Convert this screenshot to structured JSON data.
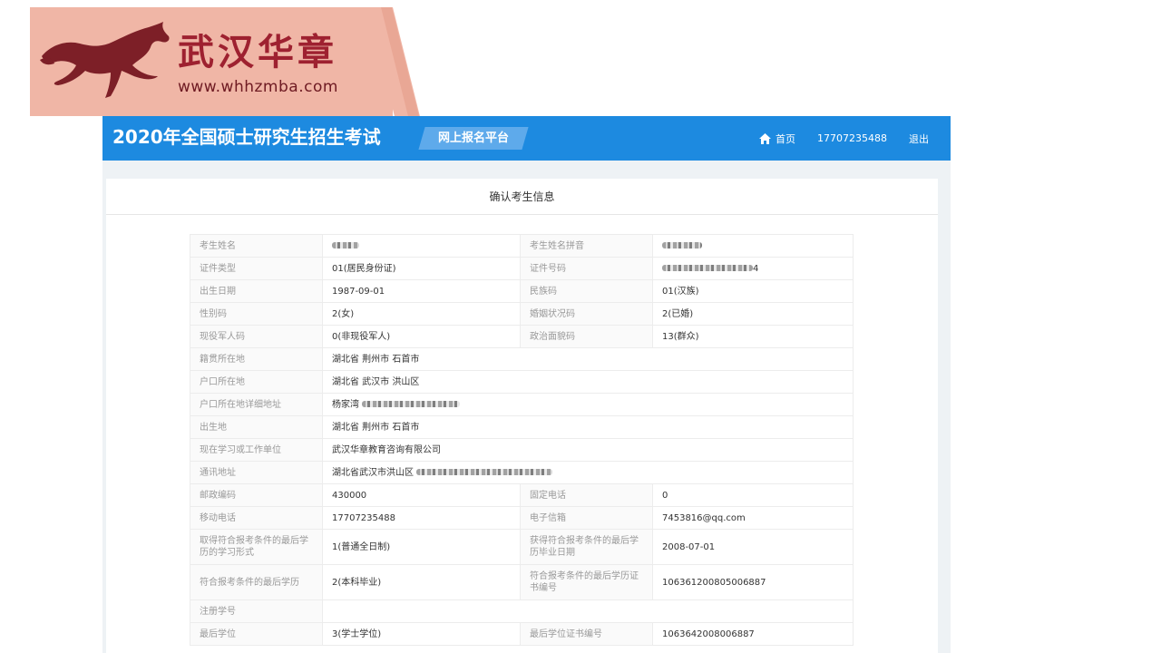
{
  "logo": {
    "name": "武汉华章",
    "url": "www.whhzmba.com",
    "colors": {
      "banner": "#f0b6a6",
      "text": "#9e2130",
      "horse": "#7d1f27"
    }
  },
  "header": {
    "title": "2020年全国硕士研究生招生考试",
    "platform": "网上报名平台",
    "nav": {
      "home": "首页",
      "phone": "17707235488",
      "logout": "退出"
    },
    "color": "#1d8ae0"
  },
  "card": {
    "title": "确认考生信息"
  },
  "info": {
    "name_label": "考生姓名",
    "pinyin_label": "考生姓名拼音",
    "id_type_label": "证件类型",
    "id_type": "01(居民身份证)",
    "id_no_label": "证件号码",
    "id_no_tail": "4",
    "birth_label": "出生日期",
    "birth": "1987-09-01",
    "ethnic_label": "民族码",
    "ethnic": "01(汉族)",
    "gender_label": "性别码",
    "gender": "2(女)",
    "marital_label": "婚姻状况码",
    "marital": "2(已婚)",
    "military_label": "现役军人码",
    "military": "0(非现役军人)",
    "political_label": "政治面貌码",
    "political": "13(群众)",
    "native_label": "籍贯所在地",
    "native": "湖北省 荆州市 石首市",
    "hukou_label": "户口所在地",
    "hukou": "湖北省 武汉市 洪山区",
    "hukou_detail_label": "户口所在地详细地址",
    "hukou_detail": "杨家湾",
    "birthplace_label": "出生地",
    "birthplace": "湖北省 荆州市 石首市",
    "employer_label": "现在学习或工作单位",
    "employer": "武汉华章教育咨询有限公司",
    "address_label": "通讯地址",
    "address": "湖北省武汉市洪山区",
    "postcode_label": "邮政编码",
    "postcode": "430000",
    "landline_label": "固定电话",
    "landline": "0",
    "mobile_label": "移动电话",
    "mobile": "17707235488",
    "email_label": "电子信箱",
    "email": "7453816@qq.com",
    "study_form_label": "取得符合报考条件的最后学历的学习形式",
    "study_form": "1(普通全日制)",
    "grad_date_label": "获得符合报考条件的最后学历毕业日期",
    "grad_date": "2008-07-01",
    "edu_label": "符合报考条件的最后学历",
    "edu": "2(本科毕业)",
    "edu_cert_label": "符合报考条件的最后学历证书编号",
    "edu_cert": "106361200805006887",
    "reg_no_label": "注册学号",
    "reg_no": "",
    "degree_label": "最后学位",
    "degree": "3(学士学位)",
    "degree_cert_label": "最后学位证书编号",
    "degree_cert": "1063642008006887"
  }
}
